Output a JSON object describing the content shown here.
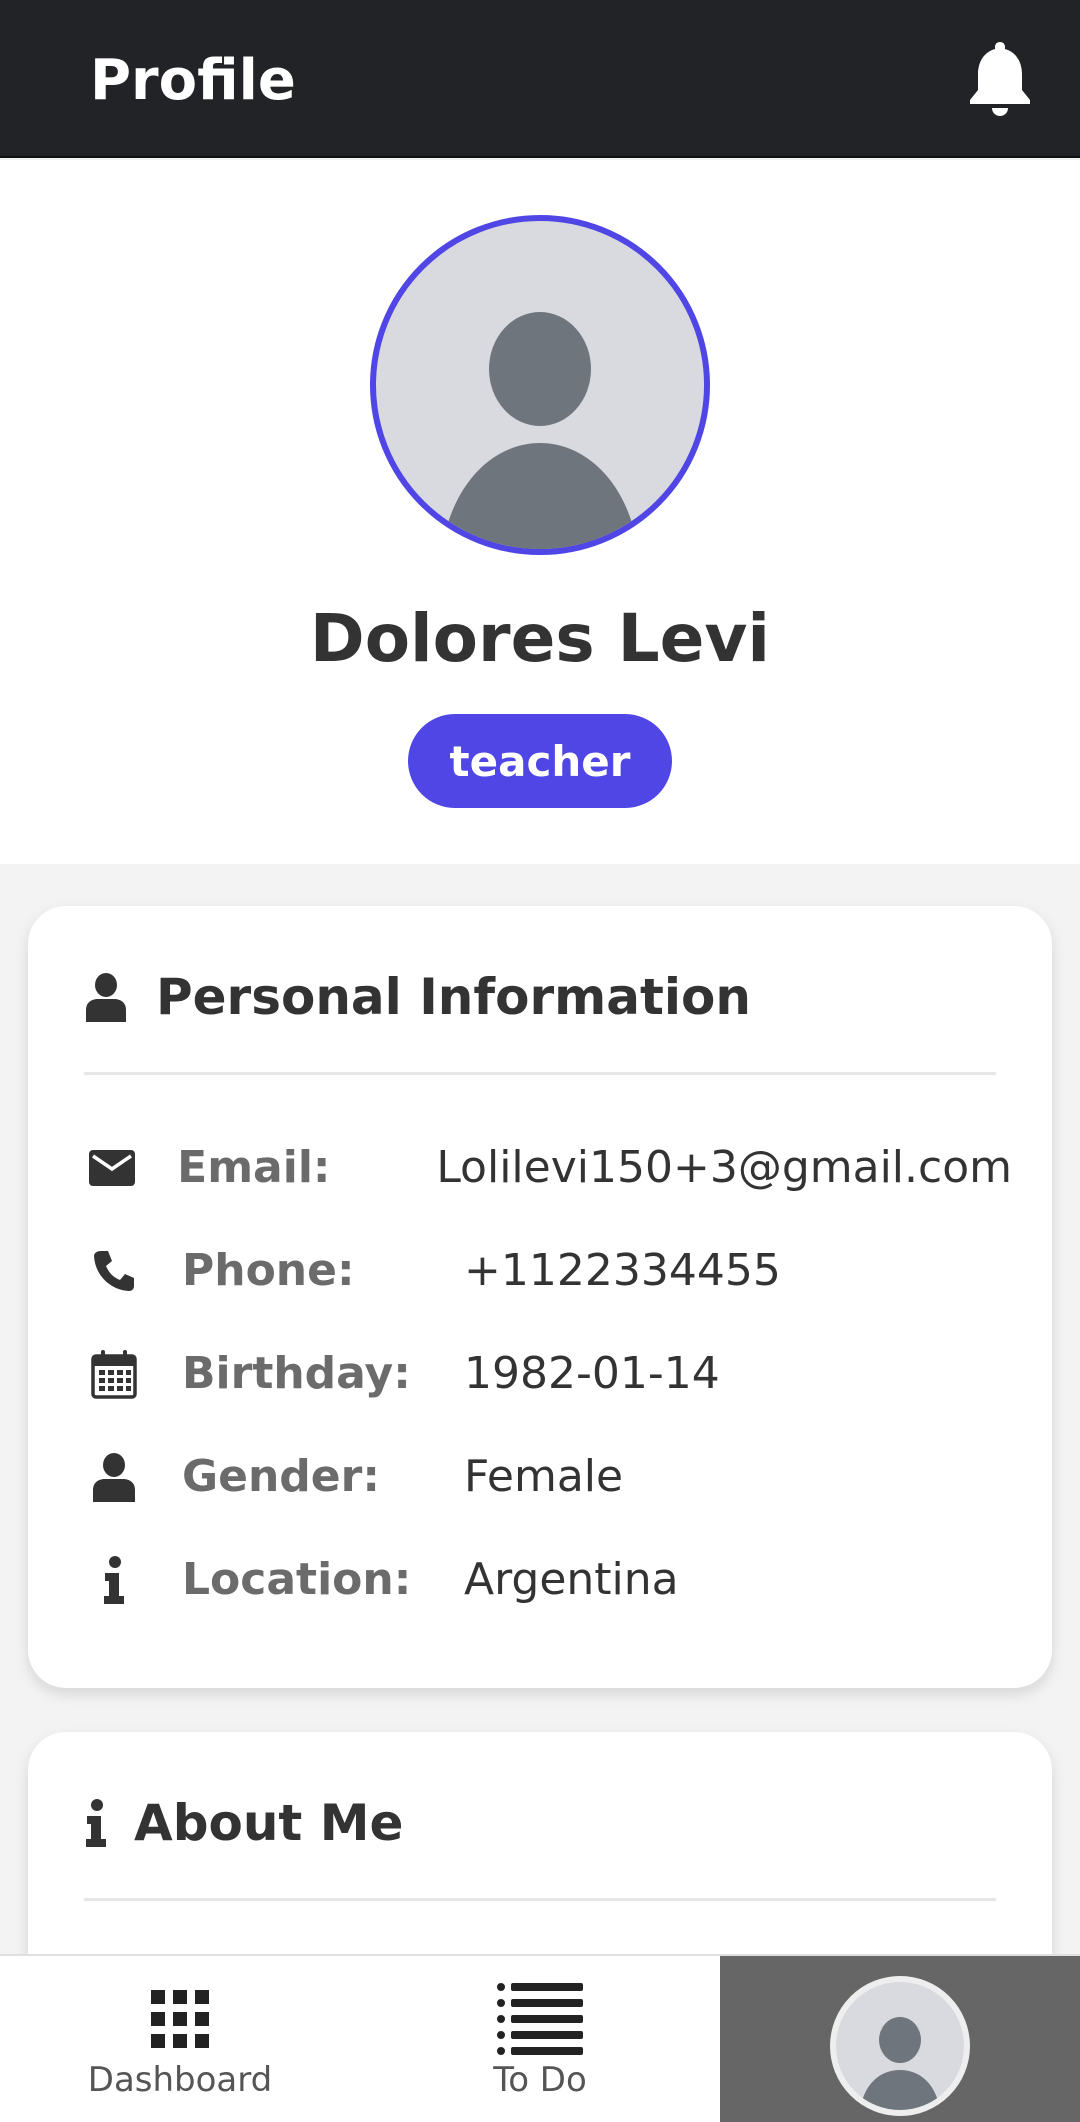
{
  "header": {
    "title": "Profile",
    "notification_icon": "bell-icon"
  },
  "profile": {
    "name": "Dolores Levi",
    "role": "teacher",
    "avatar_icon": "user-placeholder-icon"
  },
  "personal_info": {
    "title": "Personal Information",
    "title_icon": "user-icon",
    "rows": [
      {
        "icon": "envelope-icon",
        "label": "Email:",
        "value": "Lolilevi150+3@gmail.com"
      },
      {
        "icon": "phone-icon",
        "label": "Phone:",
        "value": "+1122334455"
      },
      {
        "icon": "calendar-icon",
        "label": "Birthday:",
        "value": "1982-01-14"
      },
      {
        "icon": "user-icon",
        "label": "Gender:",
        "value": "Female"
      },
      {
        "icon": "info-icon",
        "label": "Location:",
        "value": "Argentina"
      }
    ]
  },
  "about": {
    "title": "About Me",
    "title_icon": "info-icon"
  },
  "bottom_nav": {
    "items": [
      {
        "label": "Dashboard",
        "icon": "grid-icon"
      },
      {
        "label": "To Do",
        "icon": "list-icon"
      },
      {
        "label": "",
        "icon": "avatar-icon",
        "active": true
      }
    ]
  },
  "colors": {
    "accent": "#4f46e5",
    "header_bg": "#222326",
    "active_nav_bg": "#666666"
  }
}
